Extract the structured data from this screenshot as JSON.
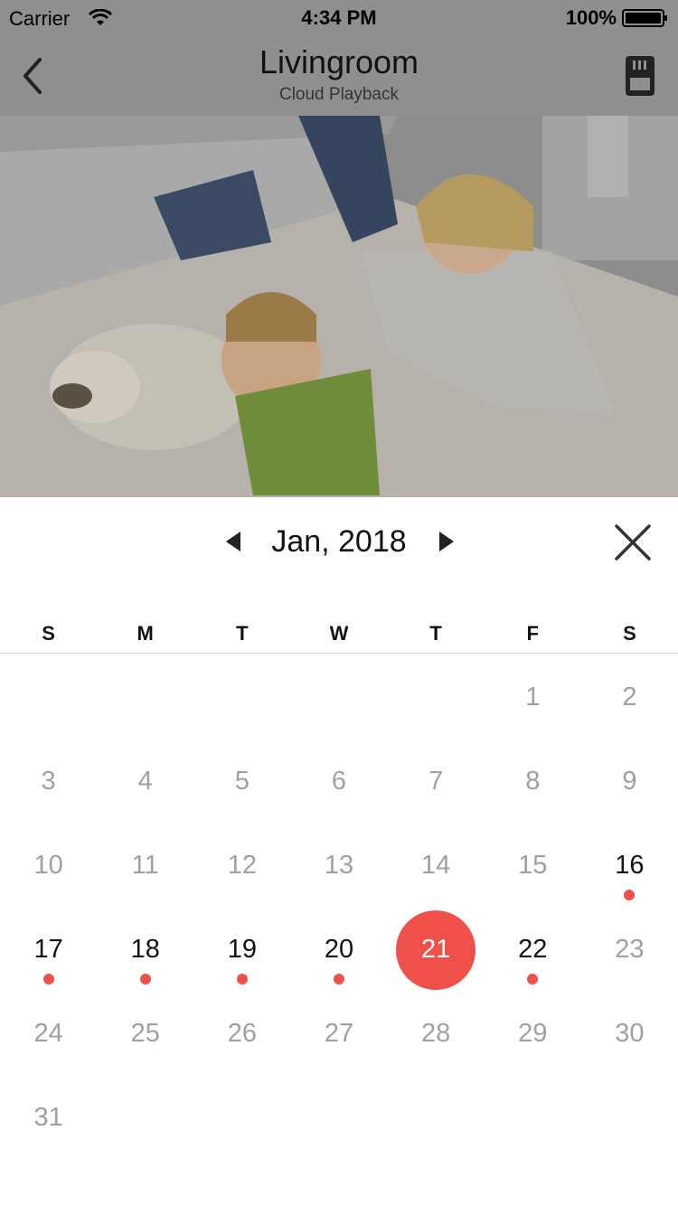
{
  "status": {
    "carrier": "Carrier",
    "time": "4:34 PM",
    "battery": "100%"
  },
  "nav": {
    "title": "Livingroom",
    "subtitle": "Cloud Playback"
  },
  "calendar": {
    "month_label": "Jan, 2018",
    "weekdays": [
      "S",
      "M",
      "T",
      "W",
      "T",
      "F",
      "S"
    ],
    "leading_blanks": 5,
    "days": [
      {
        "n": "1",
        "rec": false
      },
      {
        "n": "2",
        "rec": false
      },
      {
        "n": "3",
        "rec": false
      },
      {
        "n": "4",
        "rec": false
      },
      {
        "n": "5",
        "rec": false
      },
      {
        "n": "6",
        "rec": false
      },
      {
        "n": "7",
        "rec": false
      },
      {
        "n": "8",
        "rec": false
      },
      {
        "n": "9",
        "rec": false
      },
      {
        "n": "10",
        "rec": false
      },
      {
        "n": "11",
        "rec": false
      },
      {
        "n": "12",
        "rec": false
      },
      {
        "n": "13",
        "rec": false
      },
      {
        "n": "14",
        "rec": false
      },
      {
        "n": "15",
        "rec": false
      },
      {
        "n": "16",
        "rec": true
      },
      {
        "n": "17",
        "rec": true
      },
      {
        "n": "18",
        "rec": true
      },
      {
        "n": "19",
        "rec": true
      },
      {
        "n": "20",
        "rec": true
      },
      {
        "n": "21",
        "rec": true,
        "selected": true
      },
      {
        "n": "22",
        "rec": true
      },
      {
        "n": "23",
        "rec": false
      },
      {
        "n": "24",
        "rec": false
      },
      {
        "n": "25",
        "rec": false
      },
      {
        "n": "26",
        "rec": false
      },
      {
        "n": "27",
        "rec": false
      },
      {
        "n": "28",
        "rec": false
      },
      {
        "n": "29",
        "rec": false
      },
      {
        "n": "30",
        "rec": false
      },
      {
        "n": "31",
        "rec": false
      }
    ]
  },
  "colors": {
    "accent": "#f0504a",
    "overlay": "#8f8f8f"
  },
  "icons": {
    "back": "chevron-left-icon",
    "sd_card": "sd-card-icon",
    "prev": "triangle-left-icon",
    "next": "triangle-right-icon",
    "close": "close-icon"
  }
}
